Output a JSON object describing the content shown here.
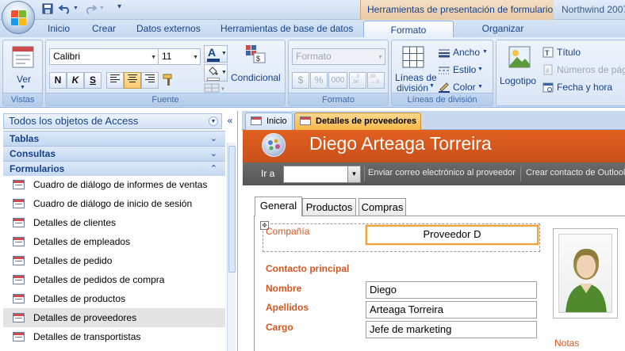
{
  "window": {
    "context_tab_title": "Herramientas de presentación de formulario",
    "app_title": "Northwind 2007"
  },
  "ribbon_tabs": [
    "Inicio",
    "Crear",
    "Datos externos",
    "Herramientas de base de datos",
    "Formato",
    "Organizar"
  ],
  "active_ribbon_tab": "Formato",
  "ribbon": {
    "vistas": {
      "ver_label": "Ver",
      "group_label": "Vistas"
    },
    "fuente": {
      "font_name": "Calibri",
      "font_size": "11",
      "bold": "N",
      "italic": "K",
      "underline": "S",
      "conditional_label": "Condicional",
      "group_label": "Fuente"
    },
    "formato": {
      "format_value": "Formato",
      "currency": "$",
      "percent": "%",
      "thousands": "000",
      "group_label": "Formato"
    },
    "lineas": {
      "gridlines_label_1": "Líneas de",
      "gridlines_label_2": "división",
      "ancho": "Ancho",
      "estilo": "Estilo",
      "color": "Color",
      "group_label": "Líneas de división"
    },
    "controles": {
      "logo_label": "Logotipo",
      "titulo": "Título",
      "numeros": "Números de pág",
      "fecha": "Fecha y hora"
    }
  },
  "nav": {
    "header": "Todos los objetos de Access",
    "categories": [
      "Tablas",
      "Consultas",
      "Formularios"
    ],
    "items": [
      "Cuadro de diálogo de informes de ventas",
      "Cuadro de diálogo de inicio de sesión",
      "Detalles de clientes",
      "Detalles de empleados",
      "Detalles de pedido",
      "Detalles de pedidos de compra",
      "Detalles de productos",
      "Detalles de proveedores",
      "Detalles de transportistas"
    ],
    "selected_index": 7
  },
  "doc_tabs": [
    "Inicio",
    "Detalles de proveedores"
  ],
  "active_doc_tab": "Detalles de proveedores",
  "form": {
    "title": "Diego Arteaga Torreira",
    "toolbar": {
      "goto_label": "Ir a",
      "goto_value": "",
      "email_link": "Enviar correo electrónico al proveedor",
      "contact_link": "Crear contacto de Outlook"
    },
    "tabs": [
      "General",
      "Productos",
      "Compras"
    ],
    "active_tab": "General",
    "labels": {
      "compania": "Compañía",
      "contacto_principal": "Contacto principal",
      "nombre": "Nombre",
      "apellidos": "Apellidos",
      "cargo": "Cargo",
      "notas": "Notas"
    },
    "values": {
      "compania": "Proveedor D",
      "nombre": "Diego",
      "apellidos": "Arteaga Torreira",
      "cargo": "Jefe de marketing"
    }
  },
  "colors": {
    "form_header": "#d9591d",
    "label_orange": "#d4561f",
    "ribbon_blue": "#c6d9f1",
    "context_orange": "#e9c9a3"
  }
}
